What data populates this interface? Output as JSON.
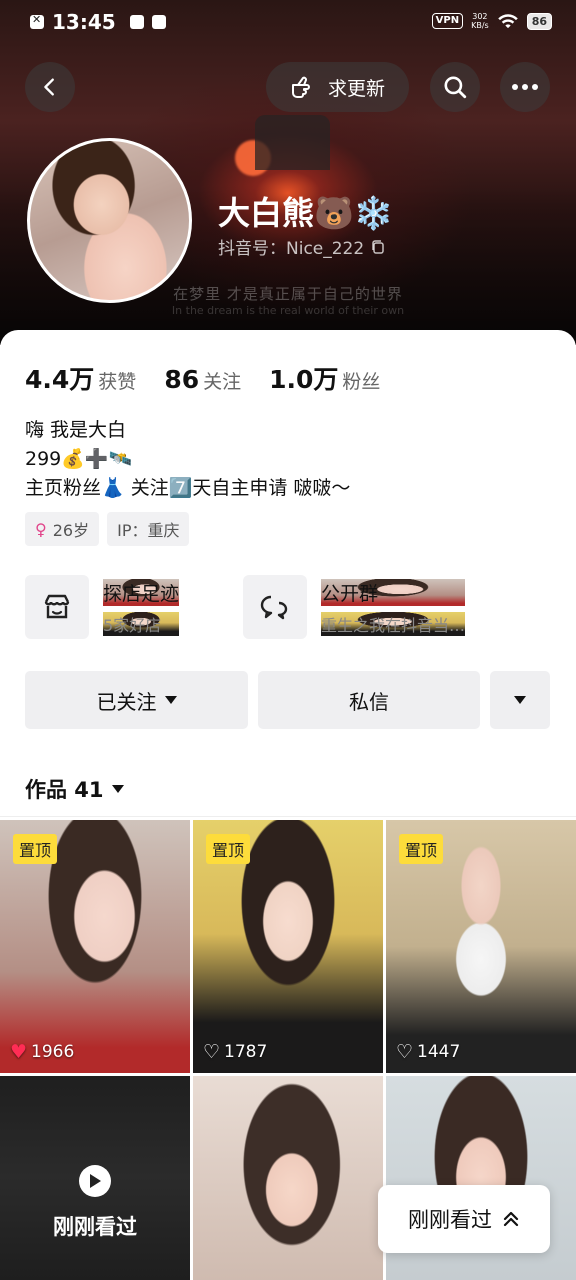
{
  "status_bar": {
    "time": "13:45",
    "vpn": "VPN",
    "speed_top": "302",
    "speed_bottom": "KB/s",
    "battery": "86"
  },
  "header": {
    "update_label": "求更新",
    "back_icon": "chevron-left-icon",
    "search_icon": "search-icon",
    "more_icon": "more-dots-icon"
  },
  "banner": {
    "text": "在梦里 才是真正属于自己的世界",
    "subtext": "In the dream is the real world of their own"
  },
  "profile": {
    "name": "大白熊🐻❄️",
    "douyin_id": "抖音号：Nice_222"
  },
  "stats": [
    {
      "num": "4.4万",
      "label": "获赞"
    },
    {
      "num": "86",
      "label": "关注"
    },
    {
      "num": "1.0万",
      "label": "粉丝"
    }
  ],
  "bio": {
    "line1": "嗨 我是大白",
    "line2": "299💰➕🛰️",
    "line3": "主页粉丝👗 关注7️⃣天自主申请 啵啵～"
  },
  "tags": {
    "age": "26岁",
    "ip": "IP：重庆"
  },
  "features": {
    "store": {
      "title": "探店足迹",
      "subtitle": "5家好店"
    },
    "group": {
      "title": "公开群",
      "subtitle": "重生之我在抖音当…"
    }
  },
  "actions": {
    "following": "已关注",
    "message": "私信"
  },
  "works": {
    "label": "作品 41"
  },
  "grid": [
    {
      "pinned": "置顶",
      "likes": "1966",
      "liked": true
    },
    {
      "pinned": "置顶",
      "likes": "1787",
      "liked": false
    },
    {
      "pinned": "置顶",
      "likes": "1447",
      "liked": false
    },
    {
      "overlay": "刚刚看过"
    },
    {},
    {}
  ],
  "float": {
    "label": "刚刚看过"
  },
  "colors": {
    "pin_bg": "#fddc3b",
    "liked_heart": "#ff2d55",
    "button_bg": "#efeff1"
  }
}
